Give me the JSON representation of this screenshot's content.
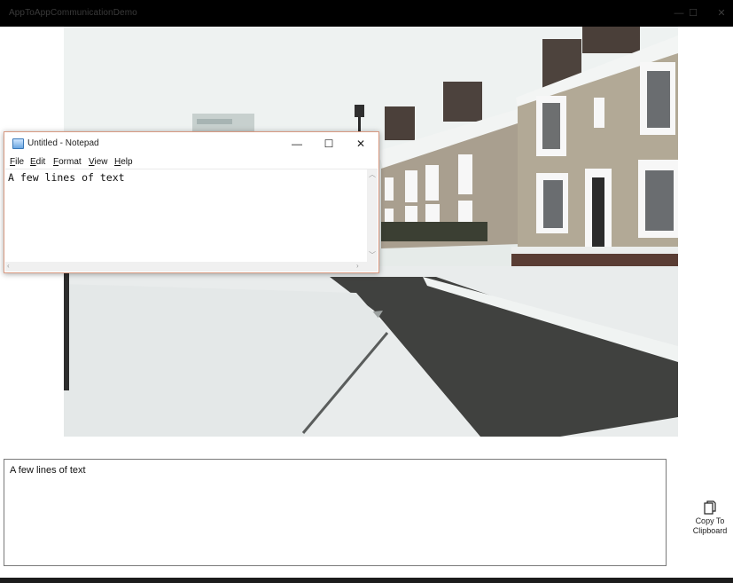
{
  "app": {
    "title": "AppToAppCommunicationDemo",
    "minimize_glyph": "—",
    "maximize_glyph": "☐",
    "close_glyph": "✕"
  },
  "photo": {
    "description_icon": "snowy-street-photo"
  },
  "notepad": {
    "title": "Untitled - Notepad",
    "minimize_glyph": "—",
    "maximize_glyph": "☐",
    "close_glyph": "✕",
    "menu": [
      "File",
      "Edit",
      "Format",
      "View",
      "Help"
    ],
    "content": "A few lines of text",
    "icon": "notepad-icon"
  },
  "text_box": {
    "value": "A few lines of text"
  },
  "copy_button": {
    "label_line1": "Copy To",
    "label_line2": "Clipboard",
    "icon": "copy-icon"
  },
  "colors": {
    "titlebar_bg": "#000000",
    "notepad_border": "#d89a82"
  }
}
